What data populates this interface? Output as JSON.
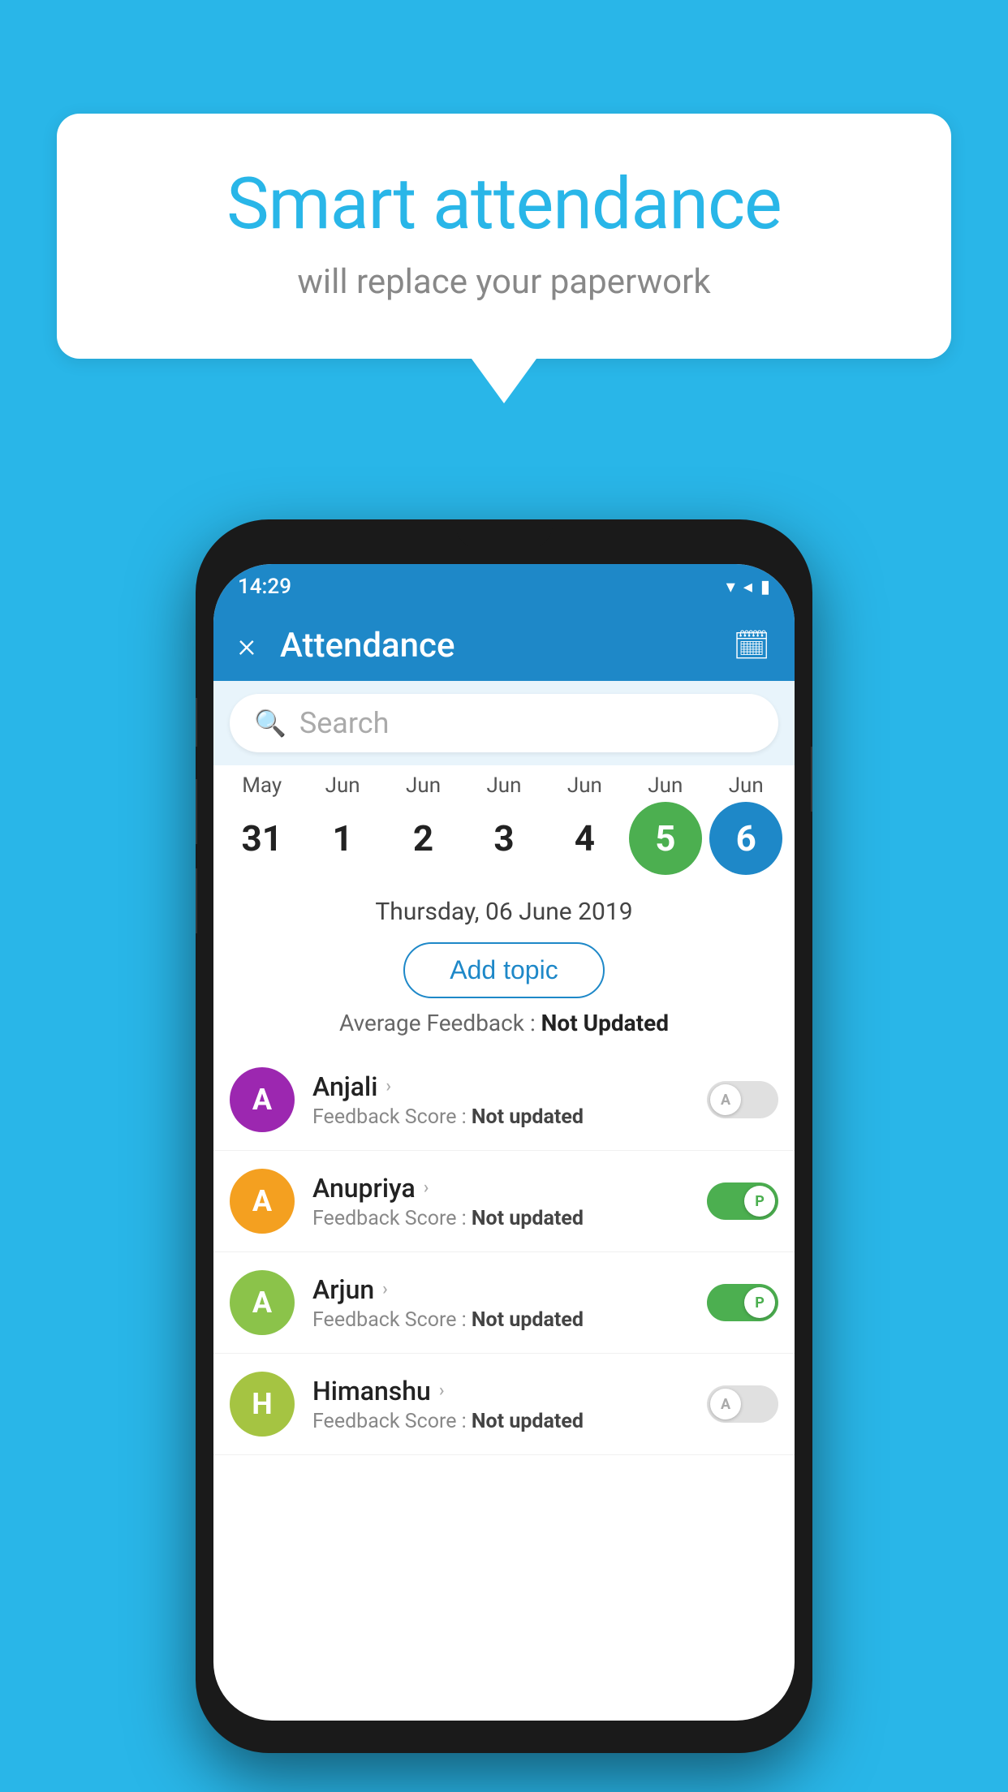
{
  "background_color": "#29b6e8",
  "speech_bubble": {
    "title": "Smart attendance",
    "subtitle": "will replace your paperwork"
  },
  "status_bar": {
    "time": "14:29",
    "wifi_icon": "▼",
    "signal_icon": "◄",
    "battery_icon": "▮"
  },
  "app_header": {
    "title": "Attendance",
    "close_label": "×",
    "calendar_icon": "📅"
  },
  "search": {
    "placeholder": "Search"
  },
  "calendar": {
    "months": [
      "May",
      "Jun",
      "Jun",
      "Jun",
      "Jun",
      "Jun",
      "Jun"
    ],
    "dates": [
      "31",
      "1",
      "2",
      "3",
      "4",
      "5",
      "6"
    ],
    "active_green_index": 5,
    "active_blue_index": 6
  },
  "selected_date": "Thursday, 06 June 2019",
  "add_topic_label": "Add topic",
  "avg_feedback": {
    "label": "Average Feedback : ",
    "value": "Not Updated"
  },
  "students": [
    {
      "name": "Anjali",
      "avatar_letter": "A",
      "avatar_color": "#9c27b0",
      "feedback_label": "Feedback Score : ",
      "feedback_value": "Not updated",
      "toggle_state": "off",
      "toggle_letter": "A"
    },
    {
      "name": "Anupriya",
      "avatar_letter": "A",
      "avatar_color": "#f4a020",
      "feedback_label": "Feedback Score : ",
      "feedback_value": "Not updated",
      "toggle_state": "on",
      "toggle_letter": "P"
    },
    {
      "name": "Arjun",
      "avatar_letter": "A",
      "avatar_color": "#8bc34a",
      "feedback_label": "Feedback Score : ",
      "feedback_value": "Not updated",
      "toggle_state": "on",
      "toggle_letter": "P"
    },
    {
      "name": "Himanshu",
      "avatar_letter": "H",
      "avatar_color": "#a5c442",
      "feedback_label": "Feedback Score : ",
      "feedback_value": "Not updated",
      "toggle_state": "off",
      "toggle_letter": "A"
    }
  ]
}
